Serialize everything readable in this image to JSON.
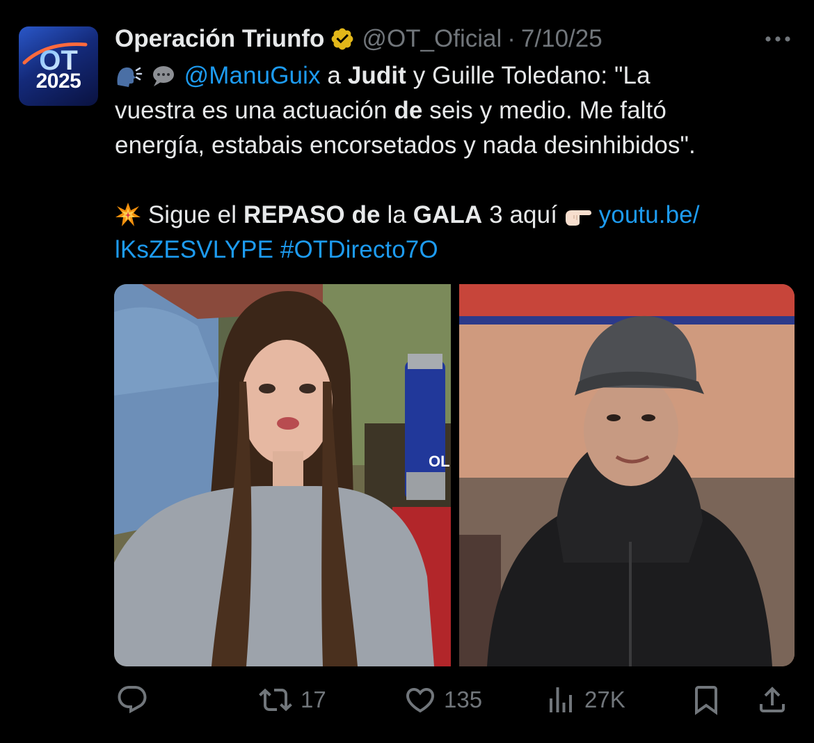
{
  "tweet": {
    "author": {
      "display_name": "Operación Triunfo",
      "handle": "@OT_Oficial",
      "avatar_text": "2025",
      "avatar_logo": "OT",
      "verified_color": "#e2b719"
    },
    "separator": "·",
    "date": "7/10/25",
    "body": {
      "line1": {
        "mention": "@ManuGuix",
        "t1": " a ",
        "b1": "Judit",
        "t2": " y Guille Toledano: \"La"
      },
      "line2": {
        "t1": "vuestra es una actuación ",
        "b1": "de",
        "t2": " seis y medio. Me faltó"
      },
      "line3": "energía, estabais encorsetados y nada desinhibidos\".",
      "line4": {
        "t1": " Sigue el ",
        "b1": "REPASO de",
        "t2": " la ",
        "b2": "GALA",
        "t3": " 3 aquí ",
        "link": "youtu.be/"
      },
      "line5": {
        "link": "lKsZESVLYPE",
        "space": " ",
        "hashtag": "#OTDirecto7O"
      }
    },
    "media": {
      "left_brand_text": "OL"
    },
    "actions": {
      "replies": "",
      "retweets": "17",
      "likes": "135",
      "views": "27K"
    },
    "colors": {
      "background": "#000000",
      "text": "#e7e9ea",
      "muted": "#71767b",
      "link": "#1d9bf0"
    },
    "icons": {
      "speaking": "speaking-head-icon",
      "speech": "speech-bubble-icon",
      "collision": "collision-icon",
      "pointing": "backhand-index-pointing-right-icon",
      "more": "more-icon",
      "reply": "reply-icon",
      "retweet": "retweet-icon",
      "like": "heart-icon",
      "views": "views-icon",
      "bookmark": "bookmark-icon",
      "share": "share-icon"
    }
  }
}
